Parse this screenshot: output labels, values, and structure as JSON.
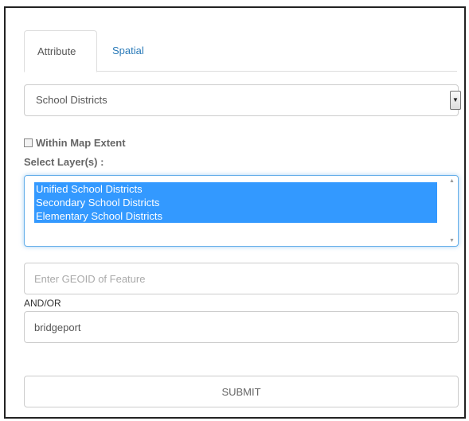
{
  "tabs": {
    "attribute_label": "Attribute",
    "spatial_label": "Spatial"
  },
  "layer_type_select": {
    "selected_value": "School Districts"
  },
  "within_map_extent": {
    "label": "Within Map Extent",
    "checked": false
  },
  "select_layers": {
    "label": "Select Layer(s) :",
    "options": [
      {
        "label": "Unified School Districts",
        "selected": true
      },
      {
        "label": "Secondary School Districts",
        "selected": true
      },
      {
        "label": "Elementary School Districts",
        "selected": true
      }
    ]
  },
  "geoid_input": {
    "placeholder": "Enter GEOID of Feature",
    "value": ""
  },
  "andor_label": "AND/OR",
  "name_input": {
    "value": "bridgeport"
  },
  "submit_label": "SUBMIT",
  "colors": {
    "link": "#2a7ab8",
    "selection": "#3399ff",
    "focus_border": "#66afe9"
  }
}
